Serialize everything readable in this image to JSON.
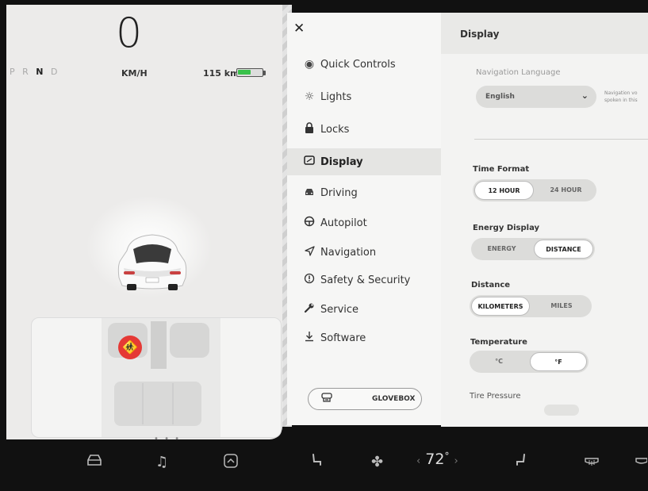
{
  "drive": {
    "gears": [
      "P",
      "R",
      "N",
      "D"
    ],
    "selected_gear": "N",
    "speed": "0",
    "speed_unit": "KM/H",
    "range": "115 km",
    "battery_level": 0.55,
    "battery_color": "#39c14a"
  },
  "menu": {
    "close_icon": "close-icon",
    "items": [
      {
        "label": "Quick Controls",
        "icon": "eye-icon"
      },
      {
        "label": "Lights",
        "icon": "light-icon"
      },
      {
        "label": "Locks",
        "icon": "lock-icon"
      },
      {
        "label": "Display",
        "icon": "display-icon",
        "active": true
      },
      {
        "label": "Driving",
        "icon": "car-icon"
      },
      {
        "label": "Autopilot",
        "icon": "steering-wheel-icon"
      },
      {
        "label": "Navigation",
        "icon": "navigation-arrow-icon"
      },
      {
        "label": "Safety & Security",
        "icon": "alert-circle-icon"
      },
      {
        "label": "Service",
        "icon": "wrench-icon"
      },
      {
        "label": "Software",
        "icon": "download-icon"
      }
    ],
    "glovebox_label": "GLOVEBOX"
  },
  "display": {
    "title": "Display",
    "nav_language_label": "Navigation Language",
    "nav_language_value": "English",
    "nav_language_note": "Navigation vo spoken in this",
    "time_format_label": "Time Format",
    "time_format_options": [
      "12 HOUR",
      "24 HOUR"
    ],
    "time_format_selected": "12 HOUR",
    "energy_display_label": "Energy Display",
    "energy_display_options": [
      "ENERGY",
      "DISTANCE"
    ],
    "energy_display_selected": "DISTANCE",
    "distance_label": "Distance",
    "distance_options": [
      "KILOMETERS",
      "MILES"
    ],
    "distance_selected": "KILOMETERS",
    "temperature_label": "Temperature",
    "temperature_options": [
      "°C",
      "°F"
    ],
    "temperature_selected": "°F",
    "tire_pressure_label": "Tire Pressure"
  },
  "bottom_bar": {
    "temperature": "72",
    "temp_unit": "°",
    "left_arrow": "‹",
    "right_arrow": "›"
  }
}
